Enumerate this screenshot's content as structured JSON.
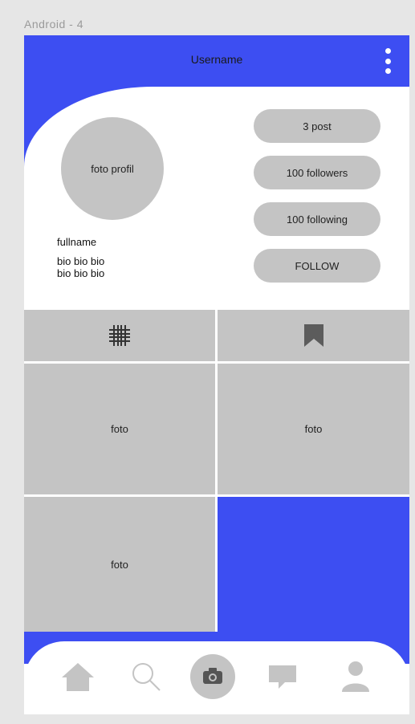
{
  "frame_label": "Android - 4",
  "appbar": {
    "title": "Username",
    "menu_icon": "kebab-menu-icon"
  },
  "profile": {
    "photo_label": "foto profil",
    "fullname": "fullname",
    "bio_line1": "bio bio bio",
    "bio_line2": "bio bio bio"
  },
  "stats": {
    "posts": "3 post",
    "followers": "100 followers",
    "following": "100 following",
    "follow_button": "FOLLOW"
  },
  "tabs": [
    {
      "icon": "grid-icon"
    },
    {
      "icon": "bookmark-icon"
    }
  ],
  "photos": [
    "foto",
    "foto",
    "foto"
  ],
  "bottom_nav": [
    {
      "icon": "home-icon"
    },
    {
      "icon": "search-icon"
    },
    {
      "icon": "camera-icon"
    },
    {
      "icon": "chat-icon"
    },
    {
      "icon": "profile-icon"
    }
  ],
  "colors": {
    "accent": "#3d4ef2",
    "placeholder": "#c4c4c4",
    "icon": "#c4c4c4"
  }
}
